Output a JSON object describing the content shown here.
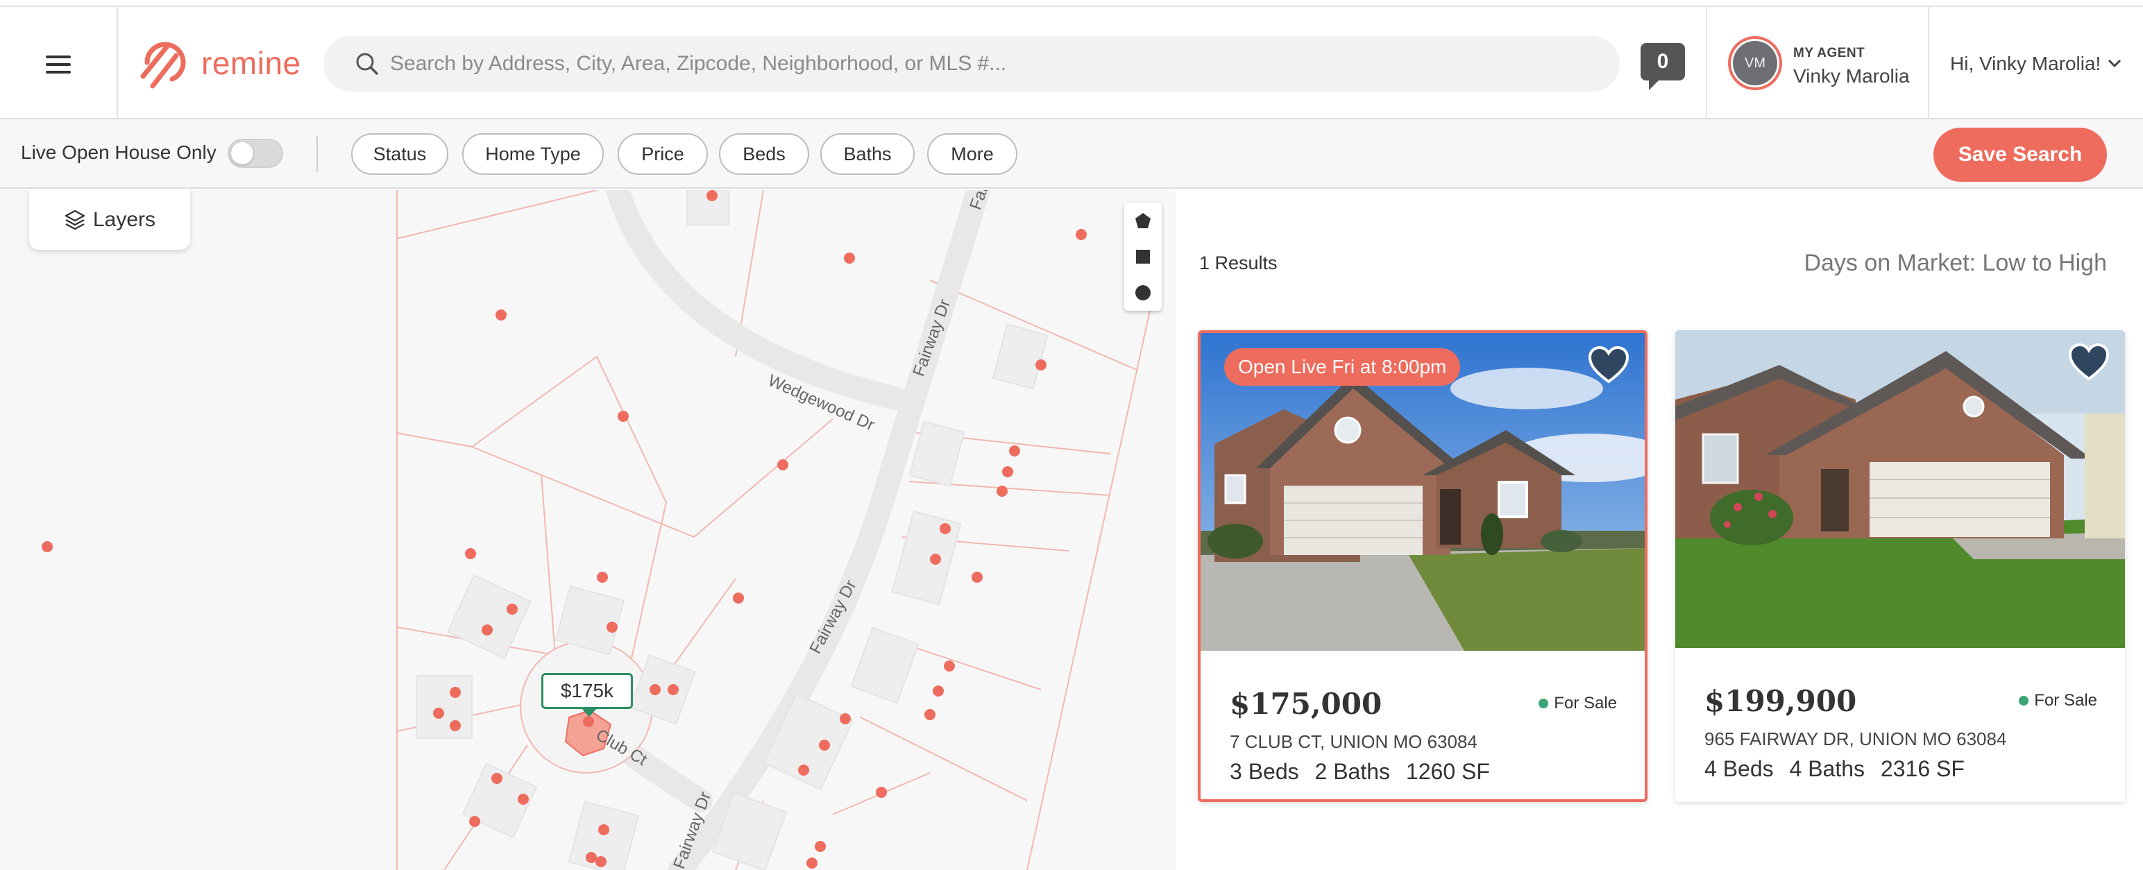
{
  "header": {
    "logo_text": "remine",
    "search_placeholder": "Search by Address, City, Area, Zipcode, Neighborhood, or MLS #...",
    "notifications_count": "0",
    "agent": {
      "initials": "VM",
      "label": "MY AGENT",
      "name": "Vinky Marolia"
    },
    "greeting": "Hi, Vinky Marolia!"
  },
  "filters": {
    "live_open_house_label": "Live Open House Only",
    "live_open_house_on": false,
    "chips": [
      "Status",
      "Home Type",
      "Price",
      "Beds",
      "Baths",
      "More"
    ],
    "save_search_label": "Save Search"
  },
  "map": {
    "layers_label": "Layers",
    "streets": [
      "Wedgewood Dr",
      "Fairway Dr",
      "Fairway Dr",
      "Club Ct",
      "Fairway Dr",
      "Fai"
    ],
    "price_marker": "$175k",
    "colors": {
      "dot": "#ee6c5e",
      "marker_border": "#2e8f62"
    }
  },
  "results": {
    "count_text": "1 Results",
    "sort_text": "Days on Market: Low to High",
    "listings": [
      {
        "badge": "Open Live Fri at 8:00pm",
        "price": "$175,000",
        "status": "For Sale",
        "address": "7 CLUB CT, UNION MO 63084",
        "beds": "3 Beds",
        "baths": "2 Baths",
        "sqft": "1260 SF"
      },
      {
        "badge": "",
        "price": "$199,900",
        "status": "For Sale",
        "address": "965 FAIRWAY DR, UNION MO 63084",
        "beds": "4 Beds",
        "baths": "4 Baths",
        "sqft": "2316 SF"
      }
    ]
  },
  "colors": {
    "accent": "#ee6c5e",
    "for_sale": "#3aa575"
  }
}
